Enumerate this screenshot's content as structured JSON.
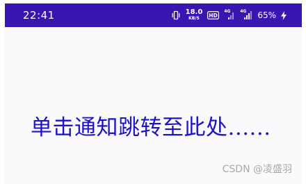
{
  "status_bar": {
    "time": "22:41",
    "net_speed_value": "18.0",
    "net_speed_unit": "KB/S",
    "hd_label": "HD",
    "signal1_label": "4G",
    "signal2_label": "4G",
    "battery_percent": "65%",
    "icons": [
      "vibrate-icon",
      "hd-icon",
      "signal-icon",
      "signal-icon",
      "charging-icon"
    ],
    "background_color": "#3a16b0"
  },
  "main": {
    "message": "单击通知跳转至此处......",
    "message_color": "#1d12c9"
  },
  "watermark": {
    "text": "CSDN @凌盛羽"
  }
}
